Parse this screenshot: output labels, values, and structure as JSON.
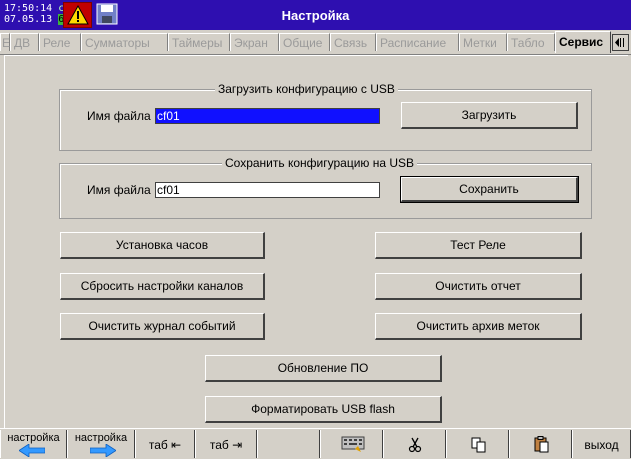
{
  "header": {
    "time": "17:50:14",
    "mode": "собт",
    "date": "07.05.13",
    "battery": "69%",
    "title": "Настройка"
  },
  "tabs": [
    {
      "label": "Е",
      "active": false
    },
    {
      "label": "ДВ",
      "active": false
    },
    {
      "label": "Реле",
      "active": false
    },
    {
      "label": "Сумматоры",
      "active": false
    },
    {
      "label": "Таймеры",
      "active": false
    },
    {
      "label": "Экран",
      "active": false
    },
    {
      "label": "Общие",
      "active": false
    },
    {
      "label": "Связь",
      "active": false
    },
    {
      "label": "Расписание",
      "active": false
    },
    {
      "label": "Метки",
      "active": false
    },
    {
      "label": "Табло",
      "active": false
    },
    {
      "label": "Сервис",
      "active": true
    }
  ],
  "load_group": {
    "title": "Загрузить конфигурацию с USB",
    "file_label": "Имя файла",
    "file_value": "cf01",
    "button": "Загрузить"
  },
  "save_group": {
    "title": "Сохранить конфигурацию на USB",
    "file_label": "Имя файла",
    "file_value": "cf01",
    "button": "Сохранить"
  },
  "actions": {
    "set_clock": "Установка часов",
    "test_relay": "Тест Реле",
    "reset_channels": "Сбросить настройки каналов",
    "clear_report": "Очистить отчет",
    "clear_event_log": "Очистить журнал событий",
    "clear_mark_archive": "Очистить архив меток",
    "update_fw": "Обновление ПО",
    "format_usb": "Форматировать USB flash"
  },
  "toolbar": {
    "settings_prev": "настройка",
    "settings_next": "настройка",
    "tab_back": "таб ⇤",
    "tab_fwd": "таб ⇥",
    "exit": "выход"
  },
  "colors": {
    "titlebar": "#2e0fb0",
    "selection": "#1010ff",
    "alarm": "#c00000",
    "arrow": "#3399ff"
  }
}
